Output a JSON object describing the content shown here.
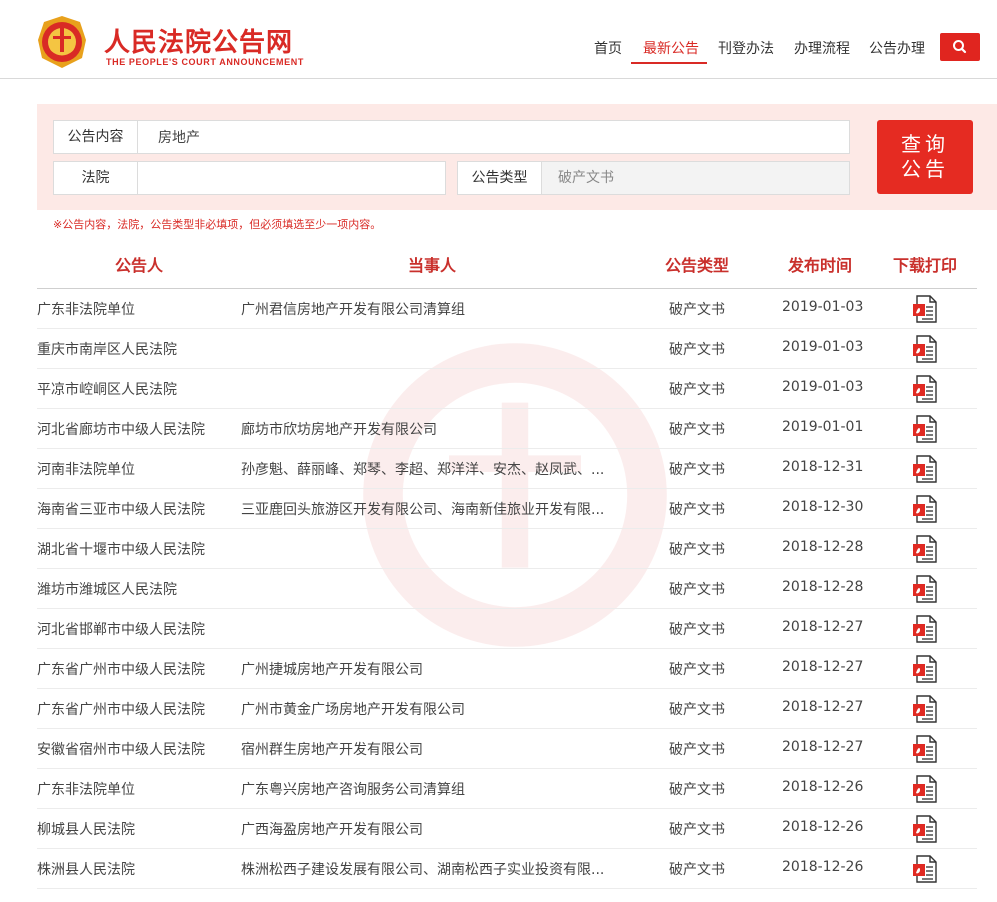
{
  "header": {
    "site_title": "人民法院公告网",
    "site_subtitle": "THE PEOPLE'S COURT ANNOUNCEMENT",
    "nav": [
      {
        "label": "首页"
      },
      {
        "label": "最新公告"
      },
      {
        "label": "刊登办法"
      },
      {
        "label": "办理流程"
      },
      {
        "label": "公告办理"
      }
    ],
    "active_nav": "最新公告",
    "search_icon": "search-icon"
  },
  "query": {
    "content_label": "公告内容",
    "content_value": "房地产",
    "court_label": "法院",
    "court_value": "",
    "type_label": "公告类型",
    "type_value": "破产文书",
    "submit_label": "查询公告",
    "note": "※公告内容，法院，公告类型非必填项，但必须填选至少一项内容。"
  },
  "table": {
    "headers": {
      "publisher": "公告人",
      "party": "当事人",
      "type": "公告类型",
      "date": "发布时间",
      "download": "下载打印"
    },
    "rows": [
      {
        "publisher": "广东非法院单位",
        "party": "广州君信房地产开发有限公司清算组",
        "type": "破产文书",
        "date": "2019-01-03"
      },
      {
        "publisher": "重庆市南岸区人民法院",
        "party": "",
        "type": "破产文书",
        "date": "2019-01-03"
      },
      {
        "publisher": "平凉市崆峒区人民法院",
        "party": "",
        "type": "破产文书",
        "date": "2019-01-03"
      },
      {
        "publisher": "河北省廊坊市中级人民法院",
        "party": "廊坊市欣坊房地产开发有限公司",
        "type": "破产文书",
        "date": "2019-01-01"
      },
      {
        "publisher": "河南非法院单位",
        "party": "孙彦魁、薛丽峰、郑琴、李超、郑洋洋、安杰、赵凤武、...",
        "type": "破产文书",
        "date": "2018-12-31"
      },
      {
        "publisher": "海南省三亚市中级人民法院",
        "party": "三亚鹿回头旅游区开发有限公司、海南新佳旅业开发有限...",
        "type": "破产文书",
        "date": "2018-12-30"
      },
      {
        "publisher": "湖北省十堰市中级人民法院",
        "party": "",
        "type": "破产文书",
        "date": "2018-12-28"
      },
      {
        "publisher": "潍坊市潍城区人民法院",
        "party": "",
        "type": "破产文书",
        "date": "2018-12-28"
      },
      {
        "publisher": "河北省邯郸市中级人民法院",
        "party": "",
        "type": "破产文书",
        "date": "2018-12-27"
      },
      {
        "publisher": "广东省广州市中级人民法院",
        "party": "广州捷城房地产开发有限公司",
        "type": "破产文书",
        "date": "2018-12-27"
      },
      {
        "publisher": "广东省广州市中级人民法院",
        "party": "广州市黄金广场房地产开发有限公司",
        "type": "破产文书",
        "date": "2018-12-27"
      },
      {
        "publisher": "安徽省宿州市中级人民法院",
        "party": "宿州群生房地产开发有限公司",
        "type": "破产文书",
        "date": "2018-12-27"
      },
      {
        "publisher": "广东非法院单位",
        "party": "广东粤兴房地产咨询服务公司清算组",
        "type": "破产文书",
        "date": "2018-12-26"
      },
      {
        "publisher": "柳城县人民法院",
        "party": "广西海盈房地产开发有限公司",
        "type": "破产文书",
        "date": "2018-12-26"
      },
      {
        "publisher": "株洲县人民法院",
        "party": "株洲松西子建设发展有限公司、湖南松西子实业投资有限...",
        "type": "破产文书",
        "date": "2018-12-26"
      }
    ],
    "download_icon": "pdf-icon"
  },
  "colors": {
    "brand_red": "#d92a25",
    "panel_bg": "#fde9e6",
    "button_red": "#e52b22"
  }
}
